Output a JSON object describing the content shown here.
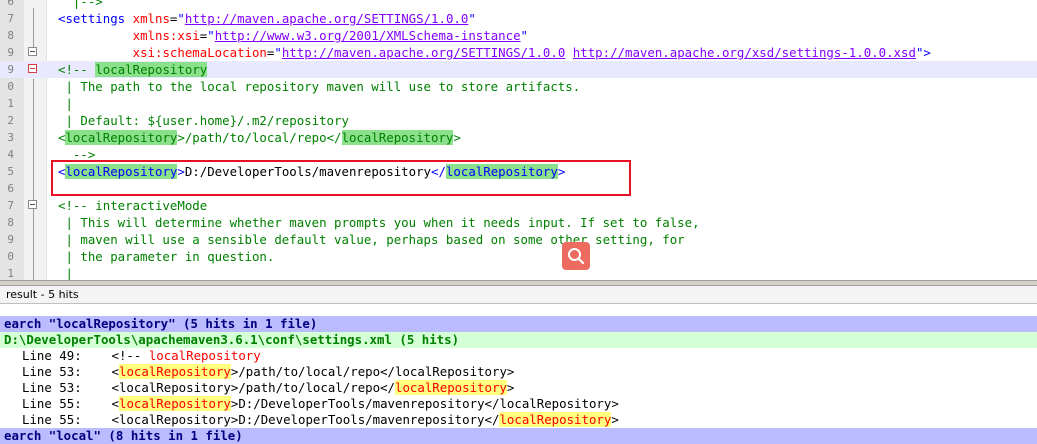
{
  "editor": {
    "lines": [
      {
        "num": "6",
        "current": false,
        "segments": [
          {
            "c": "cmt",
            "t": "  |-->"
          }
        ]
      },
      {
        "num": "7",
        "current": false,
        "segments": [
          {
            "c": "tag",
            "t": "<settings "
          },
          {
            "c": "attr",
            "t": "xmlns"
          },
          {
            "c": "txt",
            "t": "="
          },
          {
            "c": "tag",
            "t": "\""
          },
          {
            "c": "val",
            "t": "http://maven.apache.org/SETTINGS/1.0.0"
          },
          {
            "c": "tag",
            "t": "\""
          }
        ]
      },
      {
        "num": "8",
        "current": false,
        "segments": [
          {
            "c": "txt",
            "t": "          "
          },
          {
            "c": "attr",
            "t": "xmlns:xsi"
          },
          {
            "c": "txt",
            "t": "="
          },
          {
            "c": "tag",
            "t": "\""
          },
          {
            "c": "val",
            "t": "http://www.w3.org/2001/XMLSchema-instance"
          },
          {
            "c": "tag",
            "t": "\""
          }
        ]
      },
      {
        "num": "9",
        "current": false,
        "segments": [
          {
            "c": "txt",
            "t": "          "
          },
          {
            "c": "attr",
            "t": "xsi:schemaLocation"
          },
          {
            "c": "txt",
            "t": "="
          },
          {
            "c": "tag",
            "t": "\""
          },
          {
            "c": "val",
            "t": "http://maven.apache.org/SETTINGS/1.0.0"
          },
          {
            "c": "tag",
            "t": " "
          },
          {
            "c": "val",
            "t": "http://maven.apache.org/xsd/settings-1.0.0.xsd"
          },
          {
            "c": "tag",
            "t": "\">"
          }
        ]
      },
      {
        "num": "9",
        "current": true,
        "segments": [
          {
            "c": "cmt",
            "t": "<!-- "
          },
          {
            "c": "cmt hl",
            "t": "localRepository"
          }
        ]
      },
      {
        "num": "0",
        "current": false,
        "segments": [
          {
            "c": "cmt",
            "t": " | The path to the local repository maven will use to store artifacts."
          }
        ]
      },
      {
        "num": "1",
        "current": false,
        "segments": [
          {
            "c": "cmt",
            "t": " |"
          }
        ]
      },
      {
        "num": "2",
        "current": false,
        "segments": [
          {
            "c": "cmt",
            "t": " | Default: ${user.home}/.m2/repository"
          }
        ]
      },
      {
        "num": "3",
        "current": false,
        "segments": [
          {
            "c": "cmt",
            "t": "<"
          },
          {
            "c": "cmt hl",
            "t": "localRepository"
          },
          {
            "c": "cmt",
            "t": ">/path/to/local/repo</"
          },
          {
            "c": "cmt hl",
            "t": "localRepository"
          },
          {
            "c": "cmt",
            "t": ">"
          }
        ]
      },
      {
        "num": "4",
        "current": false,
        "segments": [
          {
            "c": "cmt",
            "t": "  -->"
          }
        ]
      },
      {
        "num": "5",
        "current": false,
        "segments": [
          {
            "c": "tag",
            "t": "<"
          },
          {
            "c": "tag hl",
            "t": "localRepository"
          },
          {
            "c": "tag",
            "t": ">"
          },
          {
            "c": "txt",
            "t": "D:/DeveloperTools/mavenrepository"
          },
          {
            "c": "tag",
            "t": "</"
          },
          {
            "c": "tag hl",
            "t": "localRepository"
          },
          {
            "c": "tag",
            "t": ">"
          }
        ]
      },
      {
        "num": "6",
        "current": false,
        "segments": [
          {
            "c": "txt",
            "t": ""
          }
        ]
      },
      {
        "num": "7",
        "current": false,
        "segments": [
          {
            "c": "cmt",
            "t": "<!-- interactiveMode"
          }
        ]
      },
      {
        "num": "8",
        "current": false,
        "segments": [
          {
            "c": "cmt",
            "t": " | This will determine whether maven prompts you when it needs input. If set to false,"
          }
        ]
      },
      {
        "num": "9",
        "current": false,
        "segments": [
          {
            "c": "cmt",
            "t": " | maven will use a sensible default value, perhaps based on some other setting, for"
          }
        ]
      },
      {
        "num": "0",
        "current": false,
        "segments": [
          {
            "c": "cmt",
            "t": " | the parameter in question."
          }
        ]
      },
      {
        "num": "1",
        "current": false,
        "segments": [
          {
            "c": "cmt",
            "t": " |"
          }
        ]
      }
    ]
  },
  "results": {
    "title": "result - 5 hits",
    "rows": [
      {
        "kind": "search",
        "parts": [
          {
            "c": "",
            "t": "earch \"localRepository\" (5 hits in 1 file)"
          }
        ]
      },
      {
        "kind": "file",
        "parts": [
          {
            "c": "",
            "t": "D:\\DeveloperTools\\apachemaven3.6.1\\conf\\settings.xml (5 hits)"
          }
        ]
      },
      {
        "kind": "hit",
        "parts": [
          {
            "c": "",
            "t": "Line 49:    <!-- "
          },
          {
            "c": "hitword",
            "t": "localRepository"
          }
        ]
      },
      {
        "kind": "hit",
        "parts": [
          {
            "c": "",
            "t": "Line 53:    <"
          },
          {
            "c": "hitpart",
            "t": "localRepository"
          },
          {
            "c": "",
            "t": ">/path/to/local/repo</localRepository>"
          }
        ]
      },
      {
        "kind": "hit",
        "parts": [
          {
            "c": "",
            "t": "Line 53:    <localRepository>/path/to/local/repo</"
          },
          {
            "c": "hitpart",
            "t": "localRepository"
          },
          {
            "c": "",
            "t": ">"
          }
        ]
      },
      {
        "kind": "hit",
        "parts": [
          {
            "c": "",
            "t": "Line 55:    <"
          },
          {
            "c": "hitpart",
            "t": "localRepository"
          },
          {
            "c": "",
            "t": ">D:/DeveloperTools/mavenrepository</localRepository>"
          }
        ]
      },
      {
        "kind": "hit",
        "parts": [
          {
            "c": "",
            "t": "Line 55:    <localRepository>D:/DeveloperTools/mavenrepository</"
          },
          {
            "c": "hitpart",
            "t": "localRepository"
          },
          {
            "c": "",
            "t": ">"
          }
        ]
      },
      {
        "kind": "search",
        "parts": [
          {
            "c": "",
            "t": "earch \"local\" (8 hits in 1 file)"
          }
        ]
      }
    ]
  },
  "colors": {
    "highlight": "#8be08b",
    "redbox": "#e81123",
    "search_row": "#bbbbff",
    "file_row": "#d5ffd5",
    "badge": "#ee6b5f"
  },
  "icons": {
    "badge": "search-icon"
  }
}
